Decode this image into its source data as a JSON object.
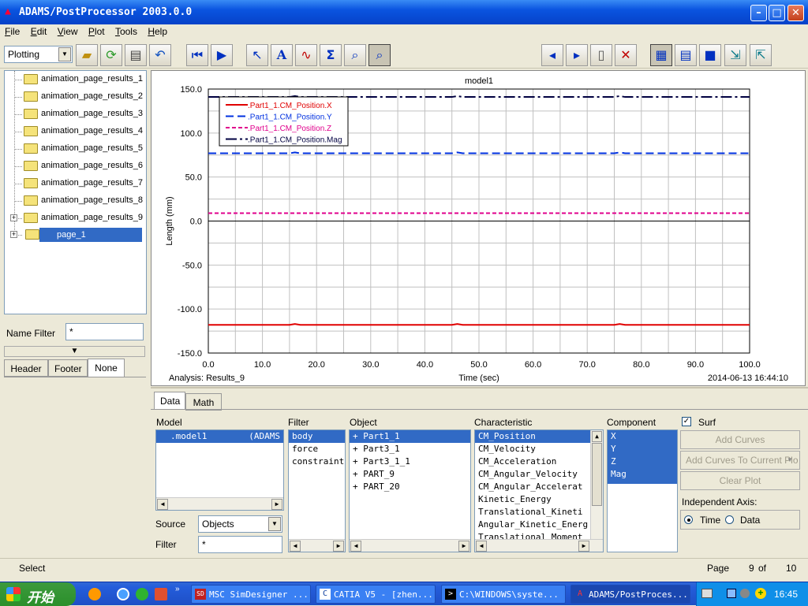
{
  "window": {
    "title": "ADAMS/PostProcessor 2003.0.0"
  },
  "menu": [
    {
      "u": "F",
      "rest": "ile"
    },
    {
      "u": "E",
      "rest": "dit"
    },
    {
      "u": "V",
      "rest": "iew"
    },
    {
      "u": "P",
      "rest": "lot"
    },
    {
      "u": "T",
      "rest": "ools"
    },
    {
      "u": "H",
      "rest": "elp"
    }
  ],
  "toolbar": {
    "mode": "Plotting"
  },
  "tree": {
    "items": [
      "animation_page_results_1",
      "animation_page_results_2",
      "animation_page_results_3",
      "animation_page_results_4",
      "animation_page_results_5",
      "animation_page_results_6",
      "animation_page_results_7",
      "animation_page_results_8",
      "animation_page_results_9",
      "page_1"
    ],
    "selected": "page_1"
  },
  "name_filter": {
    "label": "Name Filter",
    "value": "*"
  },
  "left_tabs": [
    "Header",
    "Footer",
    "None"
  ],
  "chart_data": {
    "type": "line",
    "title": "model1",
    "xlabel": "Time (sec)",
    "ylabel": "Length (mm)",
    "xlim": [
      0.0,
      100.0
    ],
    "ylim": [
      -150.0,
      150.0
    ],
    "xticks": [
      "0.0",
      "10.0",
      "20.0",
      "30.0",
      "40.0",
      "50.0",
      "60.0",
      "70.0",
      "80.0",
      "90.0",
      "100.0"
    ],
    "yticks": [
      "150.0",
      "100.0",
      "50.0",
      "0.0",
      "-50.0",
      "-100.0",
      "-150.0"
    ],
    "grid": true,
    "legend_position": "top-left",
    "series": [
      {
        "name": ".Part1_1.CM_Position.X",
        "color": "#e00000",
        "dash": "solid",
        "x": [
          0,
          15,
          16,
          17,
          45,
          46,
          47,
          75,
          76,
          77,
          100
        ],
        "y": [
          -118,
          -118,
          -117,
          -118,
          -118,
          -117,
          -118,
          -118,
          -117,
          -118,
          -118
        ]
      },
      {
        "name": ".Part1_1.CM_Position.Y",
        "color": "#0030e0",
        "dash": "dashed",
        "x": [
          0,
          15,
          16,
          17,
          45,
          46,
          47,
          75,
          76,
          77,
          100
        ],
        "y": [
          77,
          77,
          78,
          77,
          77,
          78,
          77,
          77,
          78,
          77,
          77
        ]
      },
      {
        "name": ".Part1_1.CM_Position.Z",
        "color": "#e0008c",
        "dash": "dotted",
        "x": [
          0,
          100
        ],
        "y": [
          9,
          9
        ]
      },
      {
        "name": ".Part1_1.CM_Position.Mag",
        "color": "#000040",
        "dash": "dashdot",
        "x": [
          0,
          15,
          16,
          17,
          45,
          46,
          47,
          75,
          76,
          77,
          100
        ],
        "y": [
          141,
          141,
          142,
          141,
          141,
          142,
          141,
          141,
          142,
          141,
          141
        ]
      }
    ],
    "footer_left": "Analysis:  Results_9",
    "footer_right": "2014-06-13 16:44:10"
  },
  "lower": {
    "tabs": [
      "Data",
      "Math"
    ],
    "model": {
      "label": "Model",
      "items": [
        ".model1",
        "(ADAMS"
      ]
    },
    "filter": {
      "label": "Filter",
      "items": [
        "body",
        "force",
        "constraint"
      ]
    },
    "object": {
      "label": "Object",
      "items": [
        "+ Part1_1",
        "+ Part3_1",
        "+ Part3_1_1",
        "+ PART_9",
        "+ PART_20"
      ]
    },
    "characteristic": {
      "label": "Characteristic",
      "items": [
        "CM_Position",
        "CM_Velocity",
        "CM_Acceleration",
        "CM_Angular_Velocity",
        "CM_Angular_Accelerat",
        "Kinetic_Energy",
        "Translational_Kineti",
        "Angular_Kinetic_Energ",
        "Translational_Moment"
      ]
    },
    "component": {
      "label": "Component",
      "items": [
        "X",
        "Y",
        "Z",
        "Mag"
      ]
    },
    "surf": {
      "label": "Surf",
      "checked": true
    },
    "buttons": {
      "add_curves": "Add Curves",
      "add_to_plot": "Add Curves To Current Plo",
      "clear_plot": "Clear Plot"
    },
    "independent_axis": {
      "label": "Independent Axis:",
      "time": "Time",
      "data": "Data",
      "selected": "Time"
    },
    "source": {
      "label": "Source",
      "value": "Objects"
    },
    "filter_field": {
      "label": "Filter",
      "value": "*"
    }
  },
  "status": {
    "left": "Select",
    "page_label": "Page",
    "page": "9",
    "of": "of",
    "total": "10"
  },
  "taskbar": {
    "start": "开始",
    "tasks": [
      {
        "label": "MSC SimDesigner ...",
        "icon": "SD"
      },
      {
        "label": "CATIA V5 - [zhen...",
        "icon": "C"
      },
      {
        "label": "C:\\WINDOWS\\syste...",
        "icon": ">"
      },
      {
        "label": "ADAMS/PostProces...",
        "icon": "A"
      }
    ],
    "clock": "16:45"
  }
}
